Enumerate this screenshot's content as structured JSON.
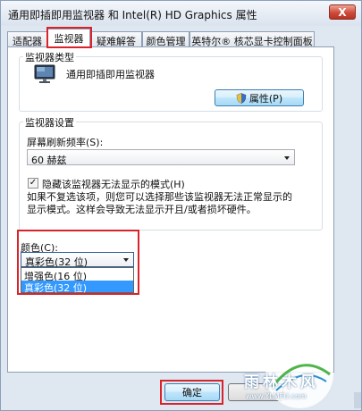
{
  "window": {
    "title": "通用即插即用监视器 和 Intel(R) HD Graphics 属性",
    "close_label": "X"
  },
  "tabs": [
    {
      "label": "适配器"
    },
    {
      "label": "监视器"
    },
    {
      "label": "疑难解答"
    },
    {
      "label": "颜色管理"
    },
    {
      "label": "英特尔® 核芯显卡控制面板"
    }
  ],
  "active_tab": 1,
  "monitor_type": {
    "group_label": "监视器类型",
    "monitor_name": "通用即插即用监视器",
    "properties_button": "属性(P)"
  },
  "monitor_settings": {
    "group_label": "监视器设置",
    "refresh_label": "屏幕刷新频率(S):",
    "refresh_value": "60 赫兹",
    "hide_modes_label": "隐藏该监视器无法显示的模式(H)",
    "hide_modes_checked": true,
    "hint_line1": "如果不复选该项，则您可以选择那些该监视器无法正常显示的",
    "hint_line2": "显示模式。这样会导致无法显示开且/或者损坏硬件。"
  },
  "colors": {
    "label": "颜色(C):",
    "selected": "真彩色(32 位)",
    "options": [
      "增强色(16 位)",
      "真彩色(32 位)"
    ],
    "highlighted_index": 1
  },
  "footer": {
    "ok_label": "确定"
  },
  "watermark": {
    "brand": "雨林木风",
    "url": "www.YLMFU.com"
  },
  "accent_colors": {
    "highlight_box": "#d8232a",
    "selection": "#3399ff"
  }
}
